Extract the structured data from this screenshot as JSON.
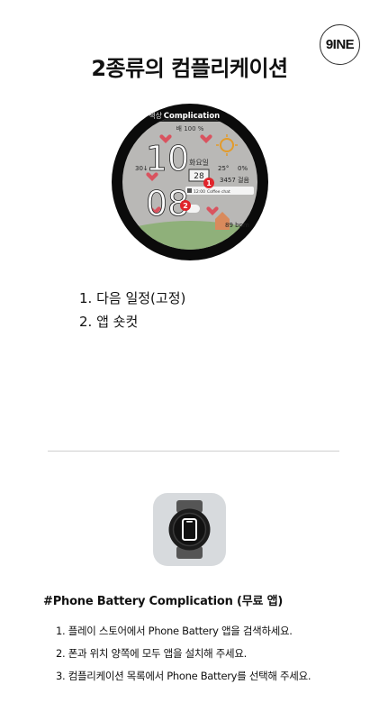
{
  "logo": {
    "text": "9INE"
  },
  "page_title": "2종류의 컴플리케이션",
  "watch_preview": {
    "header_left": "색상",
    "header_right": "Complication",
    "battery_top": "배 100 %",
    "hour": "10",
    "minute": "08",
    "day_label": "화요일",
    "date": "28",
    "temp_left": "30↓",
    "temp_right": "25°",
    "pct": "0%",
    "steps": "3457 걸음",
    "event_time": "12:00",
    "event_title": "Coffee chat",
    "hr": "89 bpm",
    "marker_1": "1",
    "marker_2": "2",
    "accent_color": "#e0242b"
  },
  "features": [
    "1. 다음 일정(고정)",
    "2. 앱 숏컷"
  ],
  "app": {
    "icon_name": "smartwatch-phone-icon"
  },
  "section_title": "#Phone Battery Complication (무료 앱)",
  "steps": [
    "1.  플레이 스토어에서 Phone Battery 앱을 검색하세요.",
    "2.  폰과 위치 양쪽에 모두 앱을 설치해 주세요.",
    "3.  컴플리케이션 목록에서 Phone Battery를 선택해 주세요."
  ]
}
